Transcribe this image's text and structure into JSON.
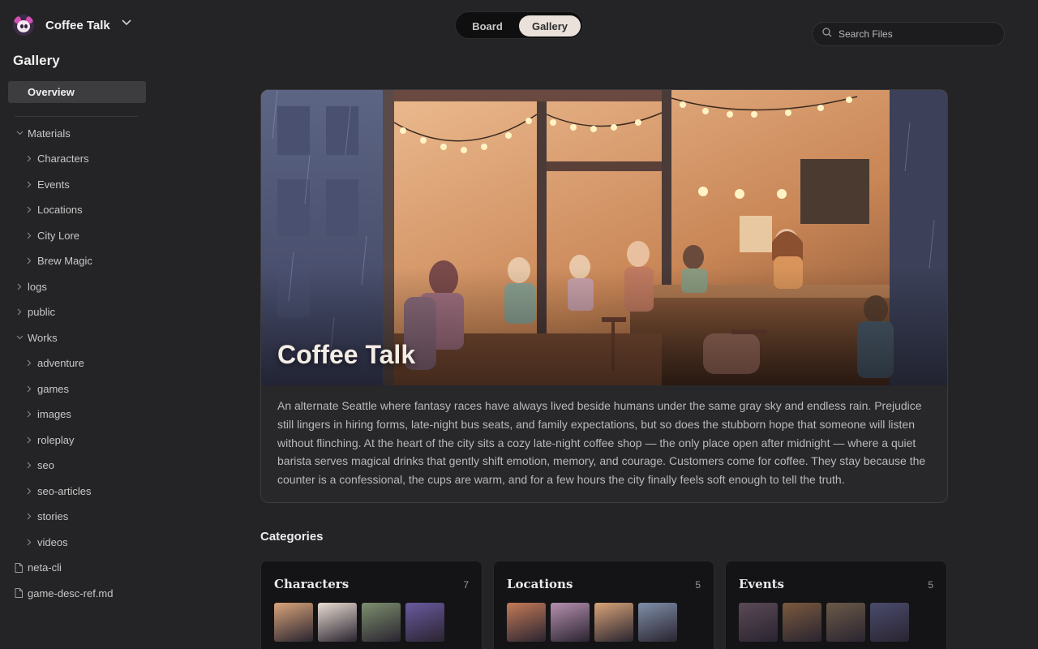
{
  "app": {
    "name": "Coffee Talk"
  },
  "sidebar": {
    "title": "Gallery",
    "overview_label": "Overview",
    "tree": [
      {
        "label": "Materials",
        "type": "folder",
        "expanded": true,
        "level": 0
      },
      {
        "label": "Characters",
        "type": "folder",
        "expanded": false,
        "level": 1
      },
      {
        "label": "Events",
        "type": "folder",
        "expanded": false,
        "level": 1
      },
      {
        "label": "Locations",
        "type": "folder",
        "expanded": false,
        "level": 1
      },
      {
        "label": "City Lore",
        "type": "folder",
        "expanded": false,
        "level": 1
      },
      {
        "label": "Brew Magic",
        "type": "folder",
        "expanded": false,
        "level": 1
      },
      {
        "label": "logs",
        "type": "folder",
        "expanded": false,
        "level": 0
      },
      {
        "label": "public",
        "type": "folder",
        "expanded": false,
        "level": 0
      },
      {
        "label": "Works",
        "type": "folder",
        "expanded": true,
        "level": 0
      },
      {
        "label": "adventure",
        "type": "folder",
        "expanded": false,
        "level": 1
      },
      {
        "label": "games",
        "type": "folder",
        "expanded": false,
        "level": 1
      },
      {
        "label": "images",
        "type": "folder",
        "expanded": false,
        "level": 1
      },
      {
        "label": "roleplay",
        "type": "folder",
        "expanded": false,
        "level": 1
      },
      {
        "label": "seo",
        "type": "folder",
        "expanded": false,
        "level": 1
      },
      {
        "label": "seo-articles",
        "type": "folder",
        "expanded": false,
        "level": 1
      },
      {
        "label": "stories",
        "type": "folder",
        "expanded": false,
        "level": 1
      },
      {
        "label": "videos",
        "type": "folder",
        "expanded": false,
        "level": 1
      },
      {
        "label": "neta-cli",
        "type": "file",
        "level": 0
      },
      {
        "label": "game-desc-ref.md",
        "type": "file",
        "level": 0
      }
    ]
  },
  "view_toggle": {
    "board": "Board",
    "gallery": "Gallery",
    "active": "Gallery"
  },
  "search": {
    "placeholder": "Search Files",
    "value": ""
  },
  "hero": {
    "title": "Coffee Talk",
    "description": "An alternate Seattle where fantasy races have always lived beside humans under the same gray sky and endless rain. Prejudice still lingers in hiring forms, late-night bus seats, and family expectations, but so does the stubborn hope that someone will listen without flinching. At the heart of the city sits a cozy late-night coffee shop — the only place open after midnight — where a quiet barista serves magical drinks that gently shift emotion, memory, and courage. Customers come for coffee. They stay because the counter is a confessional, the cups are warm, and for a few hours the city finally feels soft enough to tell the truth."
  },
  "categories": {
    "heading": "Categories",
    "cards": [
      {
        "title": "Characters",
        "count": "7",
        "thumbs": [
          "#d9a47a",
          "#e9ddd2",
          "#7d8f6e",
          "#6a5aa0"
        ]
      },
      {
        "title": "Locations",
        "count": "5",
        "thumbs": [
          "#c47a58",
          "#b690b0",
          "#d8a478",
          "#7f8fa8"
        ]
      },
      {
        "title": "Events",
        "count": "5",
        "thumbs": [
          "#5a4a56",
          "#7a5a3e",
          "#6b5a48",
          "#4a4c6e"
        ]
      }
    ]
  },
  "colors": {
    "background": "#242426",
    "accent_toggle": "#e9e1da",
    "card_bg": "#141416"
  }
}
